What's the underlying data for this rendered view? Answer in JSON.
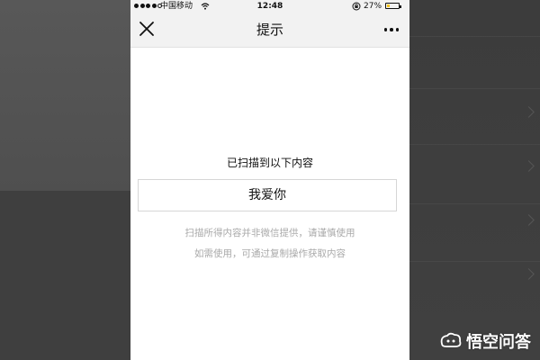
{
  "status_bar": {
    "carrier": "中国移动",
    "time": "12:48",
    "battery_percent": "27%",
    "battery_level": 0.27,
    "battery_color": "#f2c21b"
  },
  "nav": {
    "title": "提示",
    "close_icon": "close-icon",
    "more_icon": "more-icon"
  },
  "content": {
    "scan_label": "已扫描到以下内容",
    "scanned_text": "我爱你",
    "notice_line1": "扫描所得内容并非微信提供，请谨慎使用",
    "notice_line2": "如需使用，可通过复制操作获取内容"
  },
  "watermark": {
    "text": "悟空问答"
  }
}
